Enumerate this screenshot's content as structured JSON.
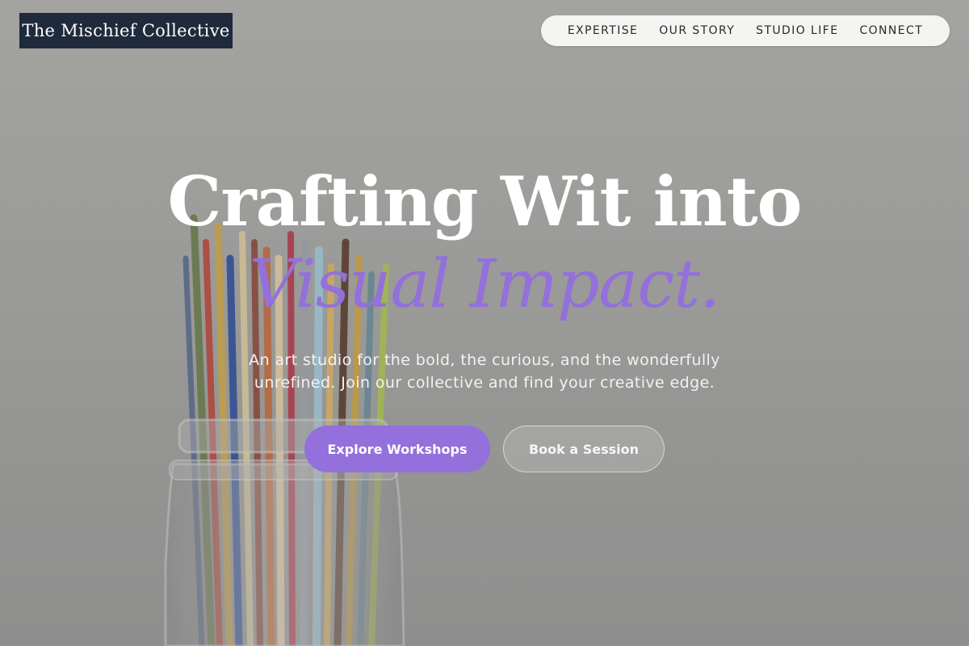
{
  "brand": {
    "name": "The Mischief Collective"
  },
  "nav": {
    "items": [
      {
        "label": "EXPERTISE"
      },
      {
        "label": "OUR STORY"
      },
      {
        "label": "STUDIO LIFE"
      },
      {
        "label": "CONNECT"
      }
    ]
  },
  "hero": {
    "headline_line1": "Crafting Wit into",
    "headline_line2": "Visual Impact.",
    "subtitle": "An art studio for the bold, the curious, and the wonderfully unrefined. Join our collective and find your creative edge.",
    "primary_button": "Explore Workshops",
    "secondary_button": "Book a Session",
    "image_subject": "paintbrushes-in-glass-jar"
  },
  "colors": {
    "brand_dark": "#1f2a3d",
    "accent": "#9370db",
    "nav_background": "#f4f4f2"
  }
}
